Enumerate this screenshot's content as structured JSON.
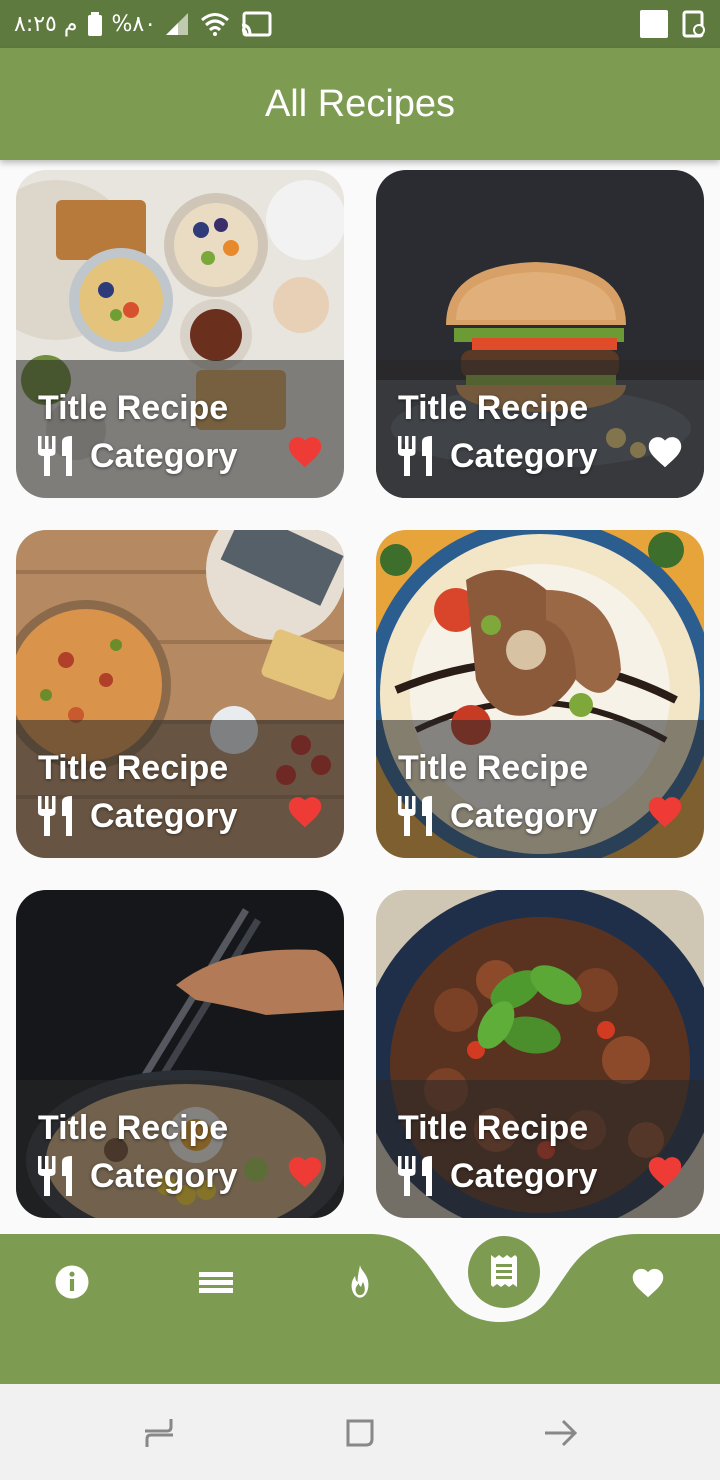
{
  "status_bar": {
    "time": "م ٨:٢٥",
    "battery": "%٨٠",
    "icons": [
      "battery-icon",
      "signal-icon",
      "wifi-icon",
      "cast-icon",
      "notification-square-icon",
      "screen-record-icon"
    ]
  },
  "app_bar": {
    "title": "All Recipes"
  },
  "recipes": [
    {
      "title": "Title Recipe",
      "category": "Category",
      "favorite": true
    },
    {
      "title": "Title Recipe",
      "category": "Category",
      "favorite": false
    },
    {
      "title": "Title Recipe",
      "category": "Category",
      "favorite": true
    },
    {
      "title": "Title Recipe",
      "category": "Category",
      "favorite": true
    },
    {
      "title": "Title Recipe",
      "category": "Category",
      "favorite": true
    },
    {
      "title": "Title Recipe",
      "category": "Category",
      "favorite": true
    }
  ],
  "bottom_nav": {
    "items": [
      "info-icon",
      "list-icon",
      "fire-icon",
      "receipt-icon",
      "heart-icon"
    ],
    "selected": "receipt-icon"
  },
  "colors": {
    "primary": "#7d9c52",
    "status_bar": "#5f7a3e",
    "favorite": "#ef3b36",
    "background": "#fafafa"
  }
}
